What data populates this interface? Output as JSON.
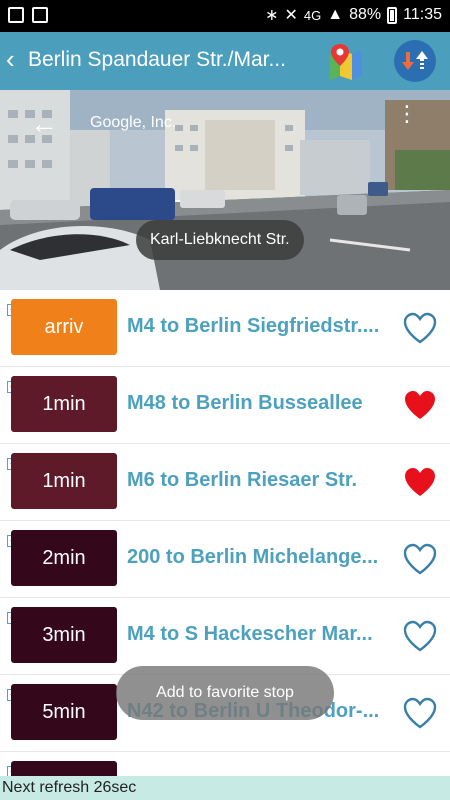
{
  "status_bar": {
    "left_icons": [
      "gallery-icon",
      "mail-icon"
    ],
    "network": "4G",
    "battery": "88%",
    "time": "11:35"
  },
  "app_bar": {
    "back_symbol": "‹",
    "title": "Berlin Spandauer Str./Mar...",
    "map_icon": "map-pin-icon",
    "refresh_icon": "swap-arrows-icon"
  },
  "street_view": {
    "back_symbol": "←",
    "provider": "Google, Inc.",
    "more_symbol": "⋮",
    "street_name": "Karl-Liebknecht Str."
  },
  "departures": [
    {
      "time": "arriv",
      "label": "M4 to Berlin Siegfriedstr....",
      "favorite": false,
      "badge_color": "#f08019"
    },
    {
      "time": "1min",
      "label": "M48 to Berlin Busseallee",
      "favorite": true,
      "badge_color": "#5e1a28"
    },
    {
      "time": "1min",
      "label": "M6 to Berlin Riesaer Str.",
      "favorite": true,
      "badge_color": "#5e1a28"
    },
    {
      "time": "2min",
      "label": "200 to Berlin Michelange...",
      "favorite": false,
      "badge_color": "#34071a"
    },
    {
      "time": "3min",
      "label": "M4 to S Hackescher Mar...",
      "favorite": false,
      "badge_color": "#34071a"
    },
    {
      "time": "5min",
      "label": "N42 to Berlin U Theodor-...",
      "favorite": false,
      "badge_color": "#34071a"
    },
    {
      "time": "",
      "label": "",
      "favorite": false,
      "badge_color": "#34071a"
    }
  ],
  "toast": {
    "text": "Add to favorite stop"
  },
  "footer": {
    "refresh_text": "Next refresh 26sec"
  },
  "colors": {
    "app_bar": "#4b9fbd",
    "route_text": "#4da1be",
    "favorite_heart": "#e8101b",
    "heart_outline": "#3a7fa8",
    "footer_bg": "#c7ebe4"
  }
}
